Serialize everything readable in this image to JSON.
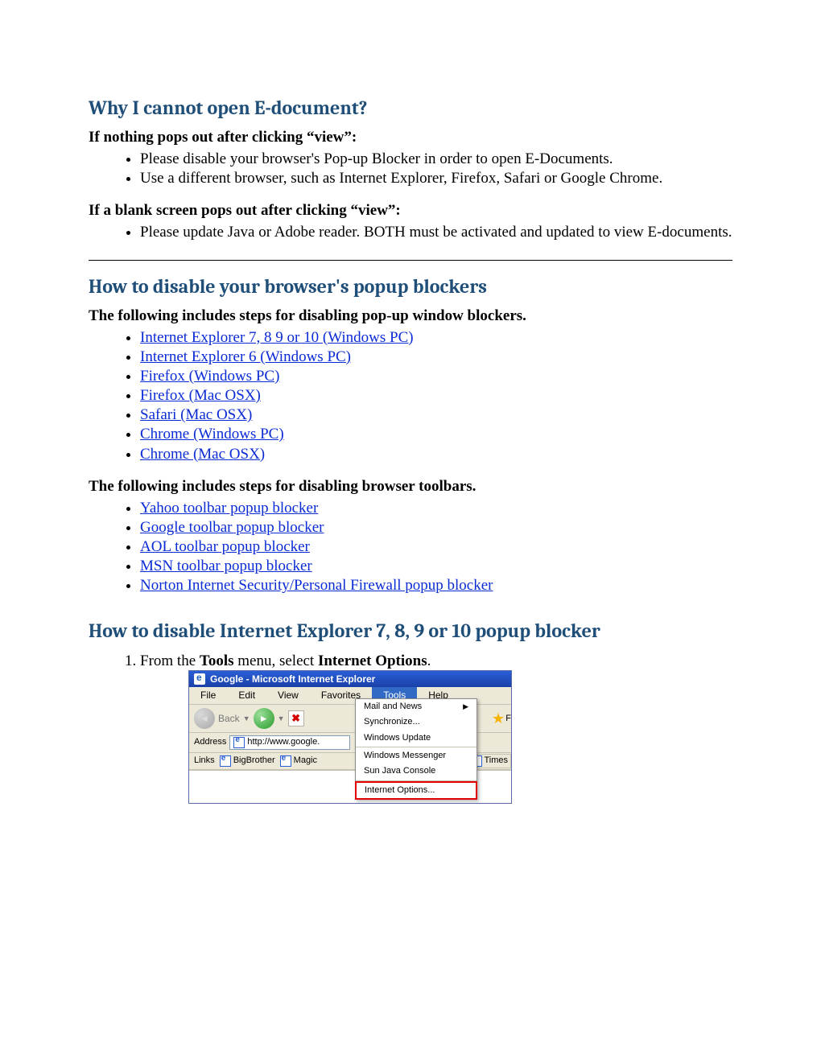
{
  "h1": "Why I cannot open E-document?",
  "sub1": "If nothing pops out after clicking “view”:",
  "bul1": [
    "Please disable your browser's Pop-up Blocker in order to open E-Documents.",
    "Use a different browser, such as Internet Explorer, Firefox, Safari or Google Chrome."
  ],
  "sub2": "If a blank screen pops out after clicking “view”:",
  "bul2": [
    "Please update Java or Adobe reader. BOTH must be activated and updated to view E-documents."
  ],
  "h2": "How to disable your browser's popup blockers",
  "sub3": "The following includes steps for disabling pop-up window blockers.",
  "links1": [
    "Internet Explorer 7, 8 9 or 10  (Windows PC)",
    "Internet Explorer 6 (Windows PC)",
    "Firefox (Windows PC)",
    "Firefox (Mac OSX)",
    "Safari (Mac OSX)",
    "Chrome (Windows PC)",
    "Chrome (Mac OSX)"
  ],
  "sub4": "The following includes steps for disabling browser toolbars.",
  "links2": [
    "Yahoo toolbar popup blocker",
    "Google toolbar popup blocker",
    "AOL toolbar popup blocker",
    "MSN toolbar popup blocker",
    "Norton Internet Security/Personal Firewall popup blocker"
  ],
  "h3": "How to disable Internet Explorer 7, 8, 9 or 10 popup blocker",
  "step1_pre": "From the ",
  "step1_b1": "Tools",
  "step1_mid": " menu, select ",
  "step1_b2": "Internet Options",
  "step1_post": ".",
  "ie": {
    "title": "Google - Microsoft Internet Explorer",
    "menu": {
      "file": "File",
      "edit": "Edit",
      "view": "View",
      "favorites": "Favorites",
      "tools": "Tools",
      "help": "Help"
    },
    "back": "Back",
    "stop": "✖",
    "address_label": "Address",
    "url": "http://www.google.",
    "links_label": "Links",
    "link_a": "BigBrother",
    "link_b": "Magic",
    "times": "Times",
    "fav_f": "F",
    "tools_menu": {
      "mail": "Mail and News",
      "sync": "Synchronize...",
      "wu": "Windows Update",
      "wm": "Windows Messenger",
      "sjc": "Sun Java Console",
      "io": "Internet Options..."
    }
  }
}
